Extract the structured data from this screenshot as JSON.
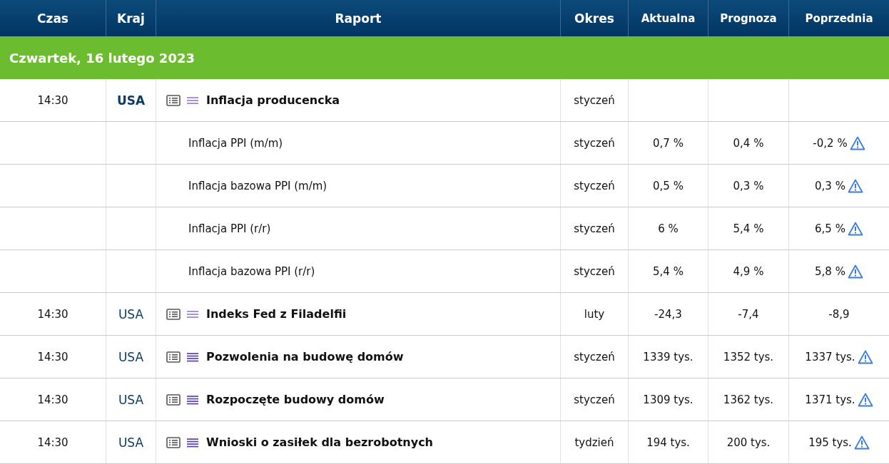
{
  "columns": [
    "Czas",
    "Kraj",
    "Raport",
    "Okres",
    "Aktualna",
    "Prognoza",
    "Poprzednia"
  ],
  "date": "Czwartek, 16 lutego 2023",
  "rows": [
    {
      "kind": "main",
      "time": "14:30",
      "country": "USA",
      "country_bold": true,
      "high_importance": false,
      "report": "Inflacja producencka",
      "period": "styczeń",
      "actual": "",
      "forecast": "",
      "previous": "",
      "revised": false
    },
    {
      "kind": "sub",
      "report": "Inflacja PPI (m/m)",
      "period": "styczeń",
      "actual": "0,7 %",
      "forecast": "0,4 %",
      "previous": "-0,2 %",
      "revised": true
    },
    {
      "kind": "sub",
      "report": "Inflacja bazowa PPI (m/m)",
      "period": "styczeń",
      "actual": "0,5 %",
      "forecast": "0,3 %",
      "previous": "0,3 %",
      "revised": true
    },
    {
      "kind": "sub",
      "report": "Inflacja PPI (r/r)",
      "period": "styczeń",
      "actual": "6 %",
      "forecast": "5,4 %",
      "previous": "6,5 %",
      "revised": true
    },
    {
      "kind": "sub",
      "report": "Inflacja bazowa PPI (r/r)",
      "period": "styczeń",
      "actual": "5,4 %",
      "forecast": "4,9 %",
      "previous": "5,8 %",
      "revised": true
    },
    {
      "kind": "main",
      "time": "14:30",
      "country": "USA",
      "country_bold": false,
      "high_importance": false,
      "report": "Indeks Fed z Filadelfii",
      "period": "luty",
      "actual": "-24,3",
      "forecast": "-7,4",
      "previous": "-8,9",
      "revised": false
    },
    {
      "kind": "main",
      "time": "14:30",
      "country": "USA",
      "country_bold": false,
      "high_importance": true,
      "report": "Pozwolenia na budowę domów",
      "period": "styczeń",
      "actual": "1339 tys.",
      "forecast": "1352 tys.",
      "previous": "1337 tys.",
      "revised": true
    },
    {
      "kind": "main",
      "time": "14:30",
      "country": "USA",
      "country_bold": false,
      "high_importance": true,
      "report": "Rozpoczęte budowy domów",
      "period": "styczeń",
      "actual": "1309 tys.",
      "forecast": "1362 tys.",
      "previous": "1371 tys.",
      "revised": true
    },
    {
      "kind": "main",
      "time": "14:30",
      "country": "USA",
      "country_bold": false,
      "high_importance": true,
      "report": "Wnioski o zasiłek dla bezrobotnych",
      "period": "tydzień",
      "actual": "194 tys.",
      "forecast": "200 tys.",
      "previous": "195 tys.",
      "revised": true
    }
  ]
}
